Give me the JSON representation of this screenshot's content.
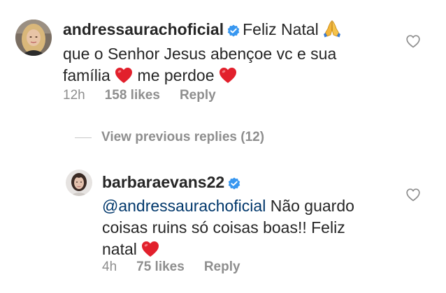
{
  "comment": {
    "username": "andressaurachoficial",
    "text_parts": [
      "Feliz Natal",
      "que o Senhor Jesus abençoe vc e sua",
      "família",
      "me perdoe"
    ],
    "time": "12h",
    "likes": "158 likes",
    "reply_label": "Reply",
    "avatar_icon": "avatar-blonde-woman",
    "verified_icon": "verified-badge-icon",
    "like_icon": "heart-outline-icon"
  },
  "view_replies": {
    "label": "View previous replies (12)"
  },
  "reply": {
    "username": "barbaraevans22",
    "mention": "@andressaurachoficial",
    "text_parts": [
      "Não guardo",
      "coisas ruins só coisas boas!! Feliz",
      "natal"
    ],
    "time": "4h",
    "likes": "75 likes",
    "reply_label": "Reply",
    "avatar_icon": "avatar-dark-hair-woman",
    "verified_icon": "verified-badge-icon",
    "like_icon": "heart-outline-icon"
  },
  "colors": {
    "verified": "#3897f0",
    "mention": "#00376b",
    "meta": "#8e8e8e",
    "heart_emoji": "#e2202c"
  }
}
